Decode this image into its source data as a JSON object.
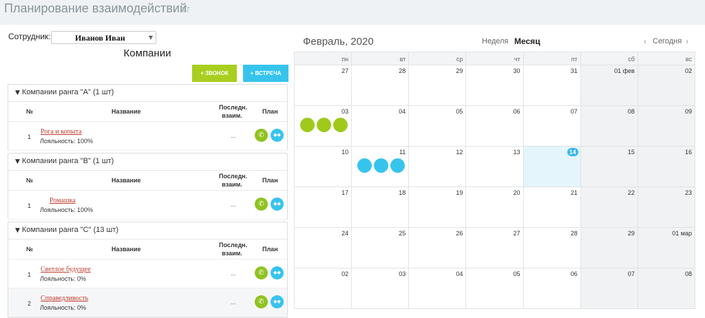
{
  "header": {
    "title": "Планирование взаимодействий",
    "star_icon": "star-icon"
  },
  "employee": {
    "label": "Сотрудник:",
    "selected": "Иванов Иван"
  },
  "companies": {
    "title": "Компании",
    "call_button": "+ ЗВОНОК",
    "meet_button": "+ ВСТРЕЧА",
    "columns": {
      "num": "№",
      "name": "Название",
      "last": "Последн. взаим.",
      "plan": "План"
    },
    "groups": [
      {
        "title": "Компании ранга \"A\" (1 шт)",
        "rows": [
          {
            "num": "1",
            "name": "Рога и копыта",
            "loyalty": "Лояльность: 100%",
            "last": "..."
          }
        ]
      },
      {
        "title": "Компании ранга \"B\" (1 шт)",
        "rows": [
          {
            "num": "1",
            "name": "Ромашка",
            "loyalty": "Лояльность: 100%",
            "last": "..."
          }
        ]
      },
      {
        "title": "Компании ранга \"C\" (13 шт)",
        "rows": [
          {
            "num": "1",
            "name": "Светлое будущее",
            "loyalty": "Лояльность: 0%",
            "last": "..."
          },
          {
            "num": "2",
            "name": "Справедливость",
            "loyalty": "Лояльность: 0%",
            "last": "..."
          }
        ]
      }
    ]
  },
  "calendar": {
    "title": "Февраль, 2020",
    "view_week": "Неделя",
    "view_month": "Месяц",
    "today_label": "Сегодня",
    "weekdays": [
      "пн",
      "вт",
      "ср",
      "чт",
      "пт",
      "сб",
      "вс"
    ],
    "weeks": [
      [
        "27",
        "28",
        "29",
        "30",
        "31",
        "01 фев",
        "02"
      ],
      [
        "03",
        "04",
        "05",
        "06",
        "07",
        "08",
        "09"
      ],
      [
        "10",
        "11",
        "12",
        "13",
        "14",
        "15",
        "16"
      ],
      [
        "17",
        "18",
        "19",
        "20",
        "21",
        "22",
        "23"
      ],
      [
        "24",
        "25",
        "26",
        "27",
        "28",
        "29",
        "01 мар"
      ],
      [
        "02",
        "03",
        "04",
        "05",
        "06",
        "07",
        "08"
      ]
    ],
    "today": "14",
    "events": [
      {
        "date": "03",
        "color": "#9fc91b",
        "count": 3,
        "kind": "call"
      },
      {
        "date": "11",
        "color": "#37c4ec",
        "count": 3,
        "kind": "meeting"
      }
    ]
  }
}
